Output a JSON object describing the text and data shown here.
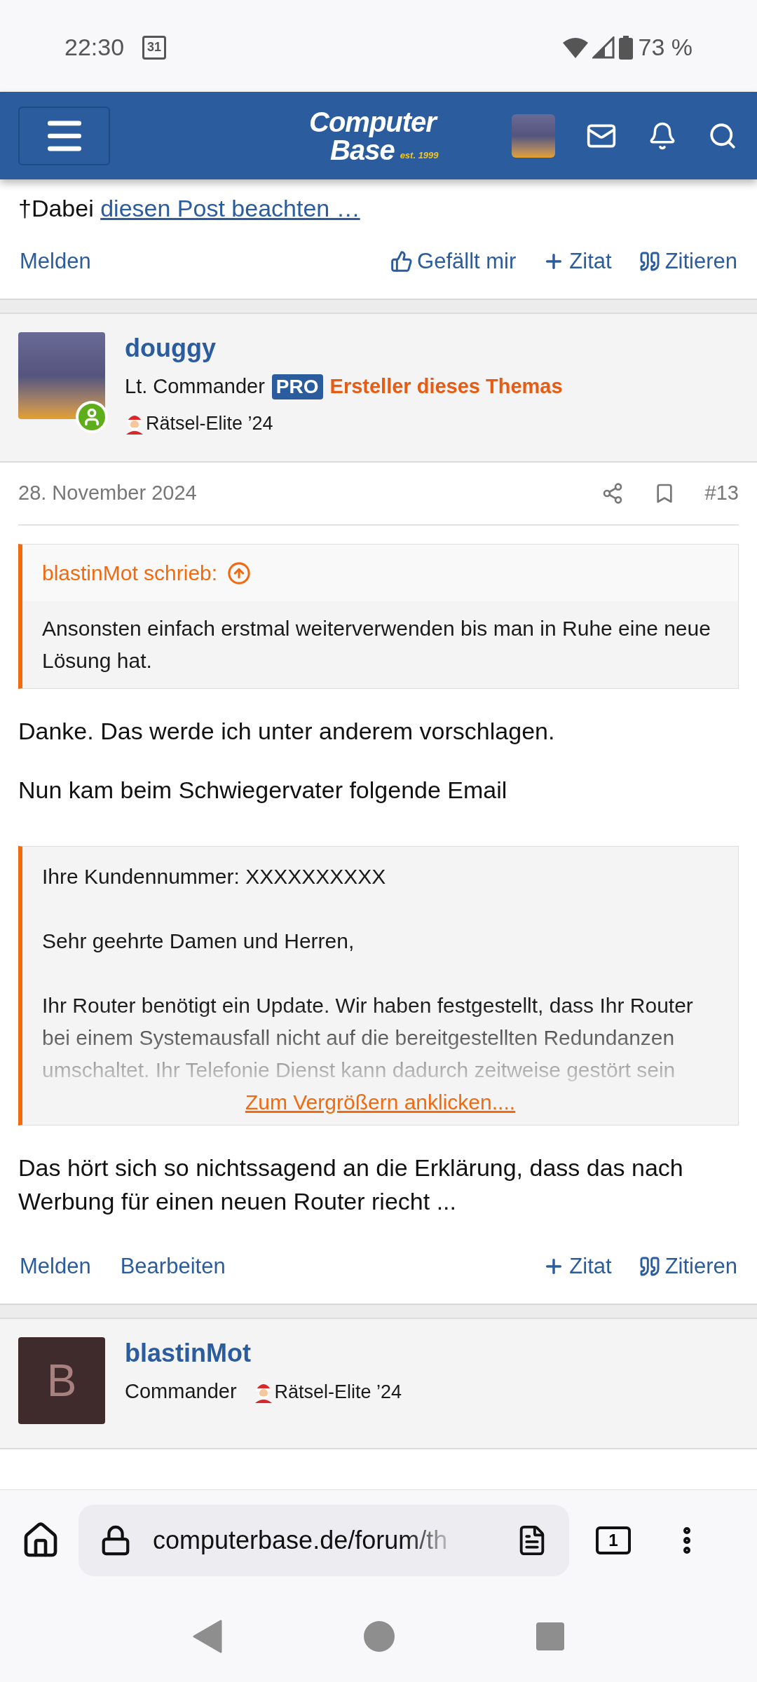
{
  "status_bar": {
    "time": "22:30",
    "calendar_day": "31",
    "battery": "73 %"
  },
  "header": {
    "logo": {
      "word_top": "Computer",
      "word_bottom": "Base",
      "tagline": "est. 1999"
    }
  },
  "previous_post": {
    "text": "†Dabei",
    "link": "diesen Post beachten …",
    "actions_left": [
      "Melden"
    ],
    "actions_right": [
      {
        "kind": "like",
        "label": "Gefällt mir"
      },
      {
        "kind": "add",
        "label": "Zitat"
      },
      {
        "kind": "quote",
        "label": "Zitieren"
      }
    ]
  },
  "posts": [
    {
      "author": {
        "name": "douggy",
        "avatar": {
          "kind": "image"
        },
        "online": true,
        "rank": "Lt. Commander",
        "badge": "PRO",
        "role": "Ersteller dieses Themas",
        "award": "Rätsel-Elite ’24"
      },
      "date": "28. November 2024",
      "number": "#13",
      "content": [
        {
          "kind": "quote",
          "author": "blastinMot schrieb:",
          "text": "Ansonsten einfach erstmal weiterverwenden bis man in Ruhe eine neue Lösung hat."
        },
        {
          "kind": "paragraph",
          "text": "Danke. Das werde ich unter anderem vorschlagen."
        },
        {
          "kind": "paragraph",
          "text": "Nun kam beim Schwiegervater folgende Email"
        },
        {
          "kind": "collapsed_quote",
          "paragraphs": [
            "Ihre Kundennummer: XXXXXXXXXX",
            "Sehr geehrte Damen und Herren,",
            "Ihr Router benötigt ein Update. Wir haben festgestellt, dass Ihr Router bei einem Systemausfall nicht auf die bereitgestellten Redundanzen umschaltet. Ihr Telefonie Dienst kann dadurch zeitweise gestört sein"
          ],
          "expand_link": "Zum Vergrößern anklicken...."
        },
        {
          "kind": "paragraph",
          "text": "Das hört sich so nichtssagend an die Erklärung, dass das nach Werbung für einen neuen Router riecht ..."
        }
      ],
      "actions_left": [
        "Melden",
        "Bearbeiten"
      ],
      "actions_right": [
        {
          "kind": "add",
          "label": "Zitat"
        },
        {
          "kind": "quote",
          "label": "Zitieren"
        }
      ]
    },
    {
      "author": {
        "name": "blastinMot",
        "avatar": {
          "kind": "letter",
          "letter": "B"
        },
        "online": false,
        "rank": "Commander",
        "award": "Rätsel-Elite ’24"
      }
    }
  ],
  "browser": {
    "url": "computerbase.de/forum/th",
    "tab_count": "1"
  }
}
